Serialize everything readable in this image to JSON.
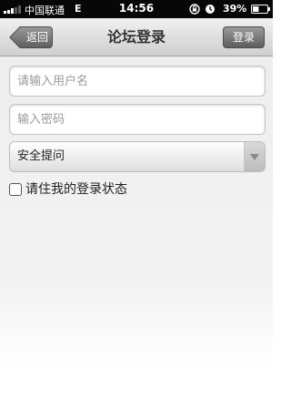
{
  "status_bar": {
    "carrier": "中国联通",
    "network": "E",
    "time": "14:56",
    "battery": "39%"
  },
  "nav": {
    "title": "论坛登录",
    "back_label": "返回",
    "login_label": "登录"
  },
  "form": {
    "username_placeholder": "请输入用户名",
    "username_value": "",
    "password_placeholder": "输入密码",
    "password_value": "",
    "security_question_selected": "安全提问",
    "remember_label": "请住我的登录状态",
    "remember_checked": false
  },
  "icons": {
    "signal": "signal-bars-icon",
    "lock": "rotation-lock-icon",
    "alarm": "alarm-clock-icon",
    "battery": "battery-icon",
    "dropdown": "chevron-down-icon"
  },
  "colors": {
    "status_bar_bg": "#070707",
    "nav_button": "#6f6f6f",
    "battery_fill": "#ffffff"
  }
}
